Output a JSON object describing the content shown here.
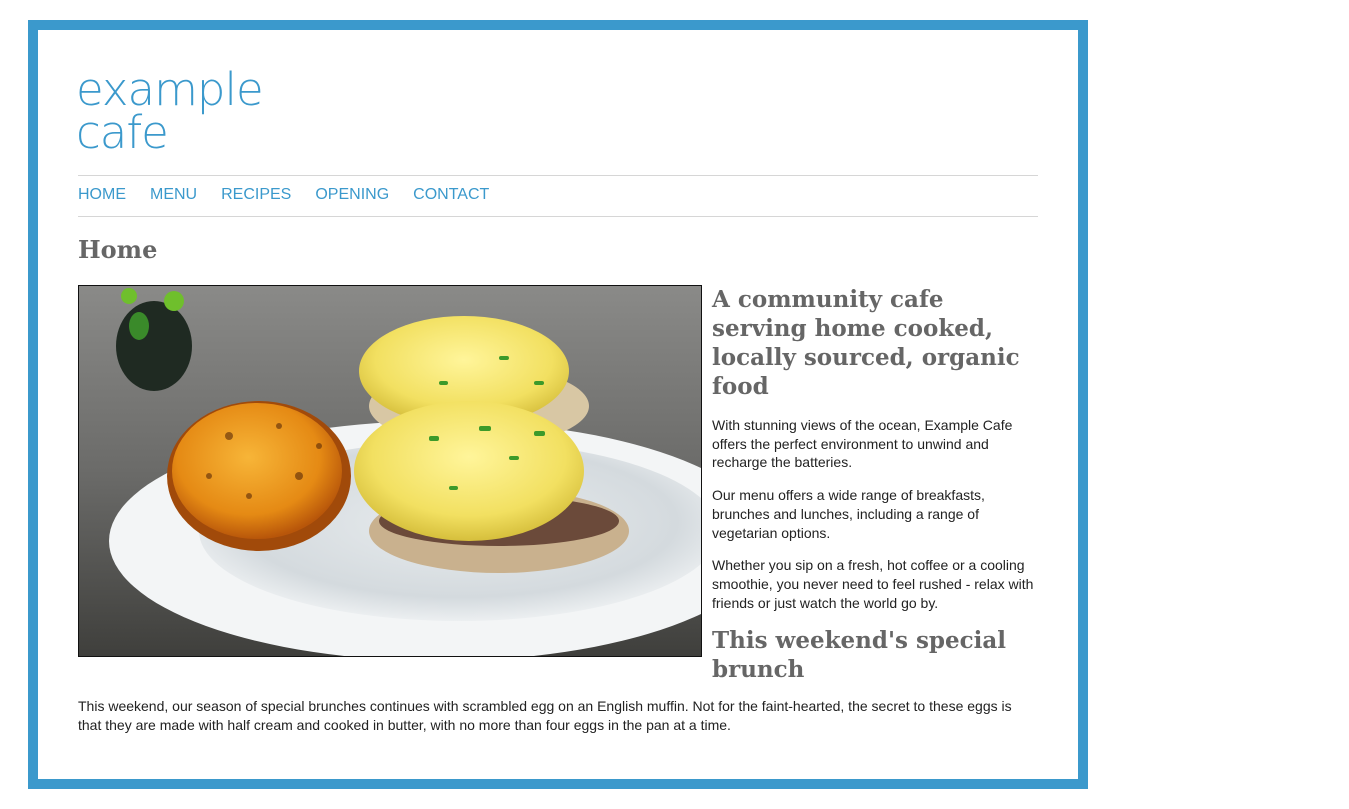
{
  "site": {
    "logo_line1": "example",
    "logo_line2": "cafe",
    "accent_color": "#3b99cc"
  },
  "nav": {
    "items": [
      "HOME",
      "MENU",
      "RECIPES",
      "OPENING",
      "CONTACT"
    ]
  },
  "page_title": "Home",
  "hero_image": {
    "icon": "brunch-photo"
  },
  "sidebar": {
    "heading": "A community cafe serving home cooked, locally sourced, organic food",
    "paragraphs": [
      "With stunning views of the ocean, Example Cafe offers the perfect environment to unwind and recharge the batteries.",
      "Our menu offers a wide range of breakfasts, brunches and lunches, including a range of vegetarian options.",
      "Whether you sip on a fresh, hot coffee or a cooling smoothie, you never need to feel rushed - relax with friends or just watch the world go by."
    ],
    "special_heading": "This weekend's special brunch"
  },
  "special_text": "This weekend, our season of special brunches continues with scrambled egg on an English muffin. Not for the faint-hearted, the secret to these eggs is that they are made with half cream and cooked in butter, with no more than four eggs in the pan at a time."
}
